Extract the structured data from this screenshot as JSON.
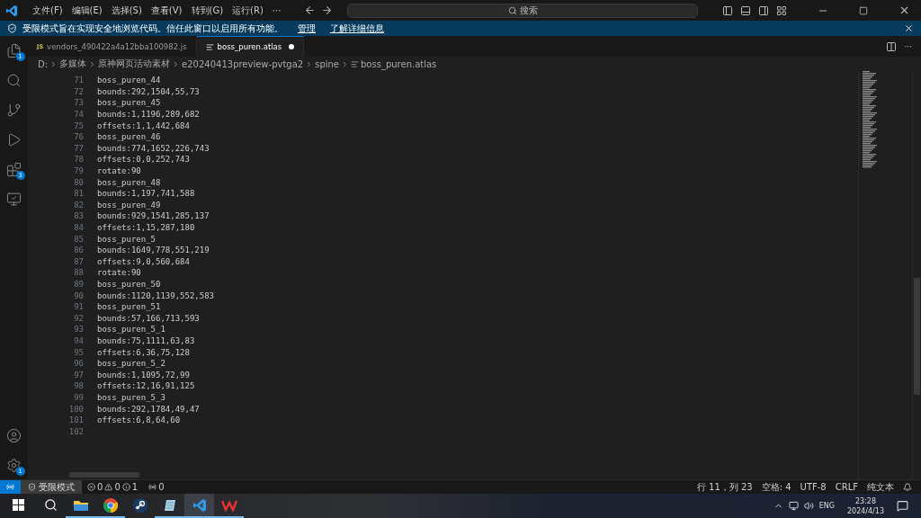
{
  "title_bar": {
    "menus": [
      "文件(F)",
      "编辑(E)",
      "选择(S)",
      "查看(V)",
      "转到(G)",
      "运行(R)"
    ],
    "more": "···",
    "search": {
      "placeholder": "搜索"
    }
  },
  "banner": {
    "message": "受限模式旨在实现安全地浏览代码。信任此窗口以启用所有功能。",
    "links": [
      "管理",
      "了解详细信息"
    ]
  },
  "activity_bar": {
    "items": [
      {
        "kind": "files",
        "badge": "1",
        "selected": false
      },
      {
        "kind": "search",
        "selected": false
      },
      {
        "kind": "source-control",
        "selected": false
      },
      {
        "kind": "run",
        "selected": false
      },
      {
        "kind": "extensions",
        "badge": "3",
        "selected": false
      },
      {
        "kind": "remote",
        "selected": false
      }
    ],
    "bottom": [
      {
        "kind": "account"
      },
      {
        "kind": "settings",
        "badge": "1"
      }
    ]
  },
  "tabs": [
    {
      "icon": "JS",
      "label": "vendors_490422a4a12bba100982.js",
      "selected": false,
      "modified": false
    },
    {
      "label": "boss_puren.atlas",
      "selected": true,
      "modified": true
    }
  ],
  "breadcrumb": [
    "D:",
    "多媒体",
    "原神网页活动素材",
    "e20240413preview-pvtga2",
    "spine",
    "boss_puren.atlas"
  ],
  "editor": {
    "lines": [
      {
        "number": "71",
        "text": "boss_puren_44"
      },
      {
        "number": "72",
        "text": "bounds:292,1504,55,73"
      },
      {
        "number": "73",
        "text": "boss_puren_45"
      },
      {
        "number": "74",
        "text": "bounds:1,1196,289,682"
      },
      {
        "number": "75",
        "text": "offsets:1,1,442,684"
      },
      {
        "number": "76",
        "text": "boss_puren_46"
      },
      {
        "number": "77",
        "text": "bounds:774,1652,226,743"
      },
      {
        "number": "78",
        "text": "offsets:0,0,252,743"
      },
      {
        "number": "79",
        "text": "rotate:90"
      },
      {
        "number": "80",
        "text": "boss_puren_48"
      },
      {
        "number": "81",
        "text": "bounds:1,197,741,588"
      },
      {
        "number": "82",
        "text": "boss_puren_49"
      },
      {
        "number": "83",
        "text": "bounds:929,1541,285,137"
      },
      {
        "number": "84",
        "text": "offsets:1,15,287,180"
      },
      {
        "number": "85",
        "text": "boss_puren_5"
      },
      {
        "number": "86",
        "text": "bounds:1649,778,551,219"
      },
      {
        "number": "87",
        "text": "offsets:9,0,560,684"
      },
      {
        "number": "88",
        "text": "rotate:90"
      },
      {
        "number": "89",
        "text": "boss_puren_50"
      },
      {
        "number": "90",
        "text": "bounds:1120,1139,552,583"
      },
      {
        "number": "91",
        "text": "boss_puren_51"
      },
      {
        "number": "92",
        "text": "bounds:57,166,713,593"
      },
      {
        "number": "93",
        "text": "boss_puren_5_1"
      },
      {
        "number": "94",
        "text": "bounds:75,1111,63,83"
      },
      {
        "number": "95",
        "text": "offsets:6,36,75,128"
      },
      {
        "number": "96",
        "text": "boss_puren_5_2"
      },
      {
        "number": "97",
        "text": "bounds:1,1095,72,99"
      },
      {
        "number": "98",
        "text": "offsets:12,16,91,125"
      },
      {
        "number": "99",
        "text": "boss_puren_5_3"
      },
      {
        "number": "100",
        "text": "bounds:292,1784,49,47"
      },
      {
        "number": "101",
        "text": "offsets:6,8,64,60"
      },
      {
        "number": "102"
      }
    ]
  },
  "status_bar": {
    "mode": "受限模式",
    "errors": "0",
    "warnings": "0",
    "infos": "1",
    "ports": "0",
    "right": [
      "行 11，列 23",
      "空格: 4",
      "UTF-8",
      "CRLF",
      "纯文本"
    ]
  },
  "taskbar": {
    "apps": [
      {
        "kind": "folder",
        "running": true,
        "selected": false
      },
      {
        "kind": "chrome",
        "running": true,
        "selected": false
      },
      {
        "kind": "steam",
        "running": false,
        "selected": false
      },
      {
        "kind": "notepad",
        "running": true,
        "selected": false
      },
      {
        "kind": "vscode",
        "running": true,
        "selected": true
      },
      {
        "kind": "wps",
        "running": true,
        "selected": false
      }
    ],
    "language": "ENG",
    "time": "23:28",
    "date": "2024/4/13"
  }
}
